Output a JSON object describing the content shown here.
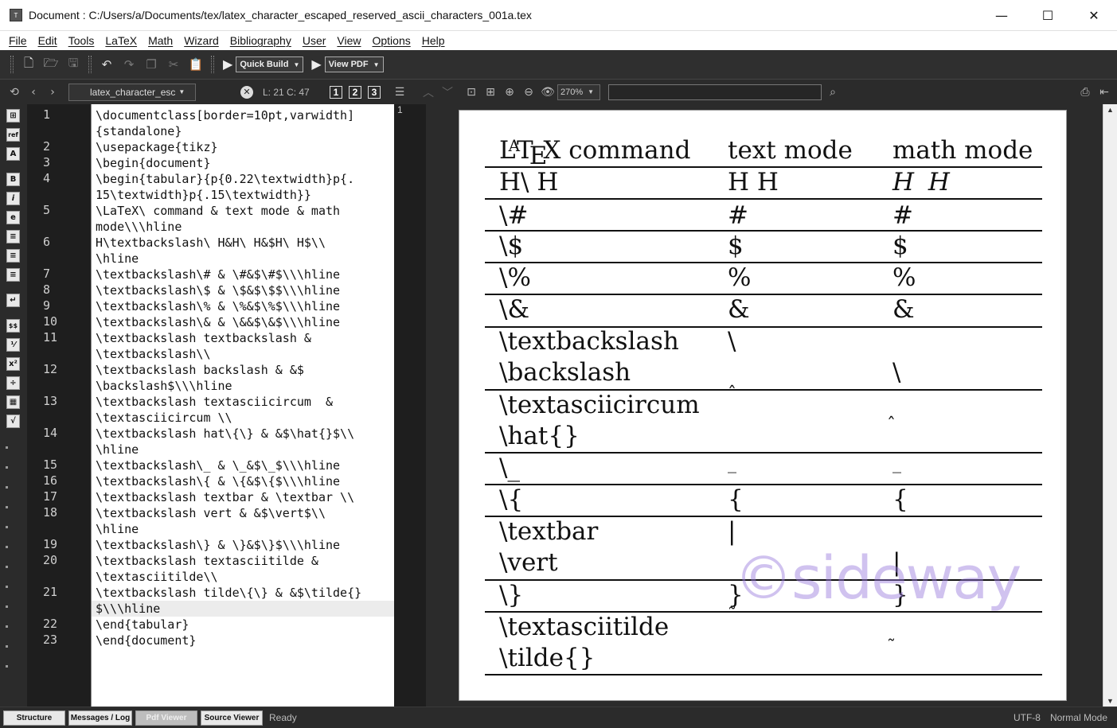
{
  "window": {
    "title": "Document : C:/Users/a/Documents/tex/latex_character_escaped_reserved_ascii_characters_001a.tex",
    "minimize": "—",
    "maximize": "☐",
    "close": "✕"
  },
  "menu": [
    "File",
    "Edit",
    "Tools",
    "LaTeX",
    "Math",
    "Wizard",
    "Bibliography",
    "User",
    "View",
    "Options",
    "Help"
  ],
  "toolbar": {
    "quick_build": "Quick Build",
    "view_pdf": "View PDF"
  },
  "toolbar2": {
    "file_combo": "latex_character_esc",
    "cursor_pos": "L: 21 C: 47",
    "view_buttons": [
      "1",
      "2",
      "3"
    ],
    "zoom": "270%",
    "search_placeholder": ""
  },
  "sidebar_icons": [
    "structure-icon",
    "ref-icon",
    "fontsize-icon",
    "bold-icon",
    "italic-icon",
    "emph-icon",
    "align-left-icon",
    "align-center-icon",
    "align-right-icon",
    "newline-icon",
    "math-dollar-icon",
    "frac-icon",
    "superscript-icon",
    "divide-icon",
    "matrix-icon",
    "sqrt-icon"
  ],
  "editor": {
    "line_numbers": [
      "1",
      "2",
      "3",
      "4",
      "5",
      "6",
      "7",
      "8",
      "9",
      "10",
      "11",
      "12",
      "13",
      "14",
      "15",
      "16",
      "17",
      "18",
      "19",
      "20",
      "21",
      "22",
      "23"
    ],
    "lines": [
      "\\documentclass[border=10pt,varwidth]",
      "{standalone}",
      "\\usepackage{tikz}",
      "\\begin{document}",
      "\\begin{tabular}{p{0.22\\textwidth}p{.",
      "15\\textwidth}p{.15\\textwidth}}",
      "\\LaTeX\\ command & text mode & math",
      "mode\\\\\\hline",
      "H\\textbackslash\\ H&H\\ H&$H\\ H$\\\\",
      "\\hline",
      "\\textbackslash\\# & \\#&$\\#$\\\\\\hline",
      "\\textbackslash\\$ & \\$&$\\$$\\\\\\hline",
      "\\textbackslash\\% & \\%&$\\%$\\\\\\hline",
      "\\textbackslash\\& & \\&&$\\&$\\\\\\hline",
      "\\textbackslash textbackslash &",
      "\\textbackslash\\\\",
      "\\textbackslash backslash & &$",
      "\\backslash$\\\\\\hline",
      "\\textbackslash textasciicircum  &",
      "\\textasciicircum \\\\",
      "\\textbackslash hat\\{\\} & &$\\hat{}$\\\\",
      "\\hline",
      "\\textbackslash\\_ & \\_&$\\_$\\\\\\hline",
      "\\textbackslash\\{ & \\{&$\\{$\\\\\\hline",
      "\\textbackslash textbar & \\textbar \\\\",
      "\\textbackslash vert & &$\\vert$\\\\",
      "\\hline",
      "\\textbackslash\\} & \\}&$\\}$\\\\\\hline",
      "\\textbackslash textasciitilde &",
      "\\textasciitilde\\\\",
      "\\textbackslash tilde\\{\\} & &$\\tilde{}",
      "$\\\\\\hline",
      "\\end{tabular}",
      "\\end{document}"
    ]
  },
  "pdf": {
    "page_number": "1",
    "header": [
      "LATEX command",
      "text mode",
      "math mode"
    ],
    "latex_logo": {
      "L": "L",
      "A": "A",
      "T": "T",
      "E": "E",
      "X": "X",
      "rest": " command"
    },
    "rows": [
      [
        "H\\ H",
        "H H",
        "H H"
      ],
      [
        "\\#",
        "#",
        "#"
      ],
      [
        "\\$",
        "$",
        "$"
      ],
      [
        "\\%",
        "%",
        "%"
      ],
      [
        "\\&",
        "&",
        "&"
      ],
      [
        "\\textbackslash",
        "\\",
        ""
      ],
      [
        "\\backslash",
        "",
        "\\"
      ],
      [
        "\\textasciicircum",
        "ˆ",
        ""
      ],
      [
        "\\hat{}",
        "",
        "ˆ"
      ],
      [
        "\\_",
        "_",
        "_"
      ],
      [
        "\\{",
        "{",
        "{"
      ],
      [
        "\\textbar",
        "|",
        ""
      ],
      [
        "\\vert",
        "",
        "|"
      ],
      [
        "\\}",
        "}",
        "}"
      ],
      [
        "\\textasciitilde",
        "˜",
        ""
      ],
      [
        "\\tilde{}",
        "",
        "˜"
      ]
    ],
    "watermark": "©sideway"
  },
  "status": {
    "buttons": [
      "Structure",
      "Messages / Log",
      "Pdf Viewer",
      "Source Viewer"
    ],
    "ready": "Ready",
    "encoding": "UTF-8",
    "mode": "Normal Mode"
  }
}
